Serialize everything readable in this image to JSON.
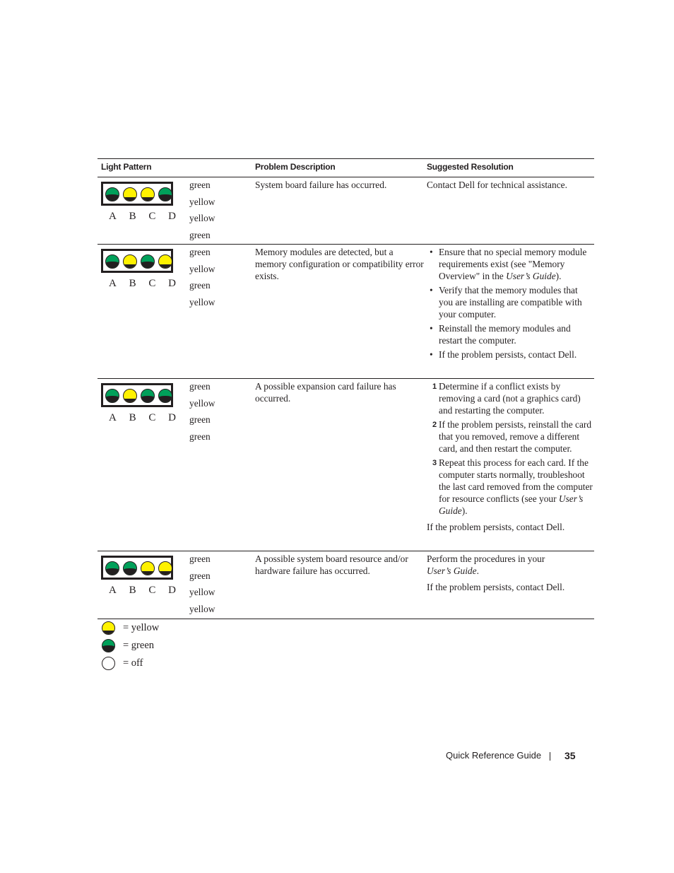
{
  "table": {
    "headers": {
      "light_pattern": "Light Pattern",
      "problem_description": "Problem Description",
      "suggested_resolution": "Suggested Resolution"
    },
    "led_letters": [
      "A",
      "B",
      "C",
      "D"
    ],
    "rows": [
      {
        "lights": [
          "green",
          "yellow",
          "yellow",
          "green"
        ],
        "description": "System board failure has occurred.",
        "resolution": {
          "text": "Contact Dell for technical assistance."
        }
      },
      {
        "lights": [
          "green",
          "yellow",
          "green",
          "yellow"
        ],
        "description": "Memory modules are detected, but a memory configuration or compatibility error exists.",
        "resolution": {
          "bullets": [
            {
              "text": "Ensure that no special memory module requirements exist (see \"Memory Overview\" in the ",
              "italic": "User’s Guide",
              "after": ")."
            },
            {
              "text": "Verify that the memory modules that you are installing are compatible with your computer."
            },
            {
              "text": "Reinstall the memory modules and restart the computer."
            },
            {
              "text": "If the problem persists, contact Dell."
            }
          ]
        }
      },
      {
        "lights": [
          "green",
          "yellow",
          "green",
          "green"
        ],
        "description": "A possible expansion card failure has occurred.",
        "resolution": {
          "steps": [
            {
              "num": "1",
              "text": "Determine if a conflict exists by removing a card (not a graphics card) and restarting the computer."
            },
            {
              "num": "2",
              "text": "If the problem persists, reinstall the card that you removed, remove a different card, and then restart the computer."
            },
            {
              "num": "3",
              "text": "Repeat this process for each card. If the computer starts normally, troubleshoot the last card removed from the computer for resource conflicts (see your ",
              "italic": "User’s Guide",
              "after": ")."
            }
          ],
          "note": "If the problem persists, contact Dell."
        }
      },
      {
        "lights": [
          "green",
          "green",
          "yellow",
          "yellow"
        ],
        "description": "A possible system board resource and/or hardware failure has occurred.",
        "resolution": {
          "text": "Perform the procedures in your ",
          "italic": "User’s Guide",
          "after": ".",
          "note": "If the problem persists, contact Dell."
        }
      }
    ]
  },
  "legend": [
    {
      "state": "yellow",
      "label": "= yellow"
    },
    {
      "state": "green",
      "label": "= green"
    },
    {
      "state": "off",
      "label": "= off"
    }
  ],
  "footer": {
    "title": "Quick Reference Guide",
    "page_number": "35"
  }
}
